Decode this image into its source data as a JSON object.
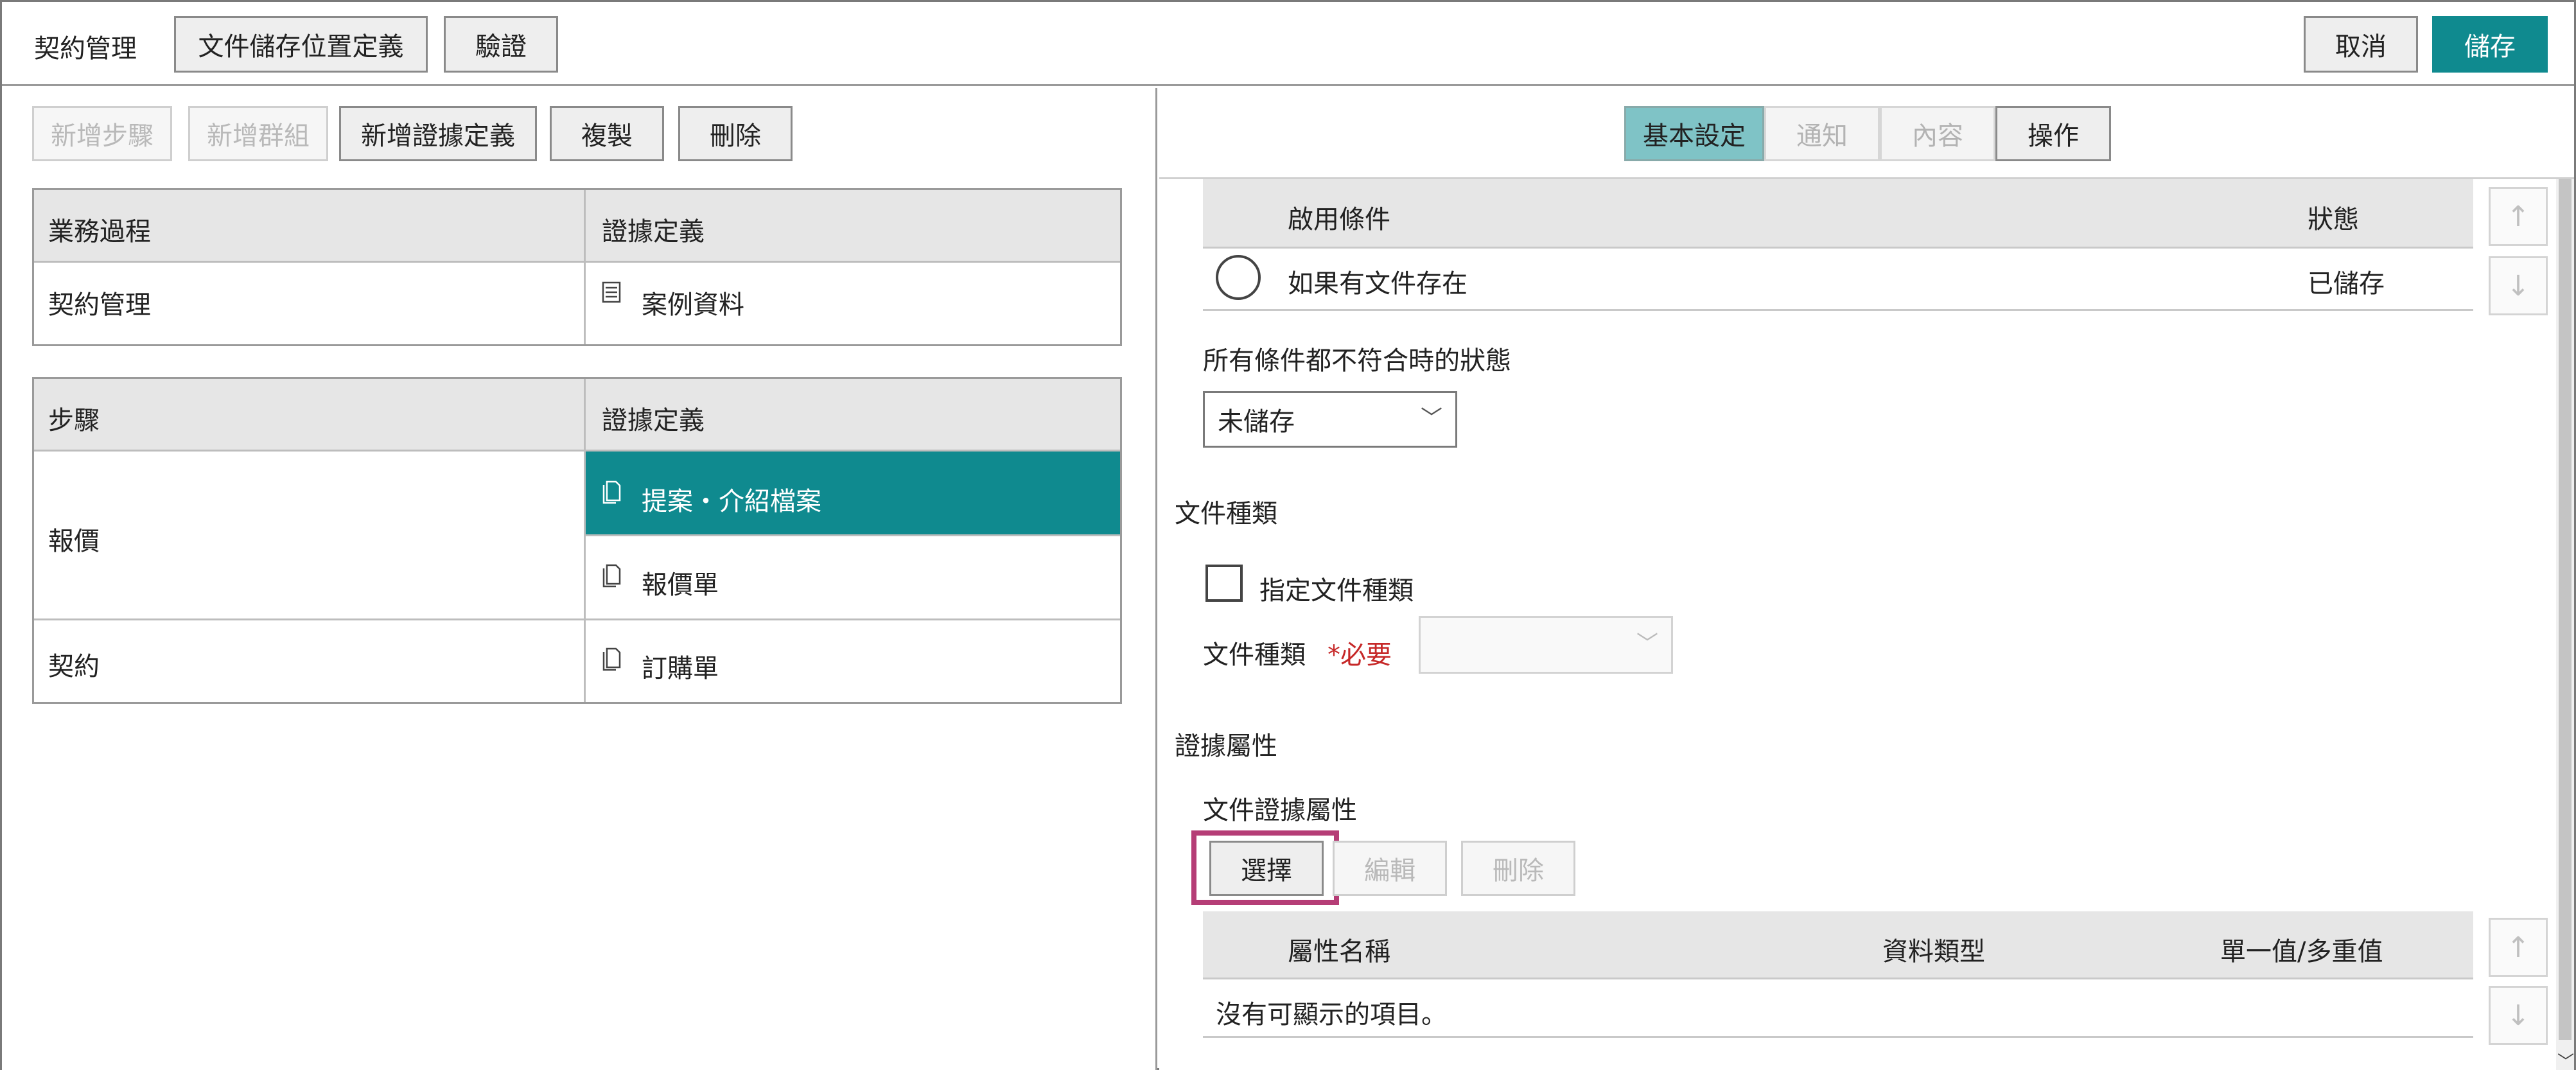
{
  "topbar": {
    "title": "契約管理",
    "storage_button": "文件儲存位置定義",
    "verify_button": "驗證",
    "cancel_button": "取消",
    "save_button": "儲存"
  },
  "left": {
    "toolbar": {
      "add_step": "新增步驟",
      "add_group": "新增群組",
      "add_evidence": "新增證據定義",
      "copy": "複製",
      "delete": "刪除"
    },
    "process_table": {
      "headers": [
        "業務過程",
        "證據定義"
      ],
      "rows": [
        {
          "process": "契約管理",
          "evidence": "案例資料",
          "icon": "list-icon"
        }
      ]
    },
    "steps_table": {
      "headers": [
        "步驟",
        "證據定義"
      ],
      "rows": [
        {
          "step": "報價",
          "evidence": [
            "提案・介紹檔案",
            "報價單"
          ]
        },
        {
          "step": "契約",
          "evidence": [
            "訂購單"
          ]
        }
      ],
      "selected": "提案・介紹檔案"
    }
  },
  "right": {
    "tabs": [
      {
        "label": "基本設定",
        "state": "active"
      },
      {
        "label": "通知",
        "state": "disabled"
      },
      {
        "label": "內容",
        "state": "disabled"
      },
      {
        "label": "操作",
        "state": "normal"
      }
    ],
    "conditions": {
      "headers": {
        "condition": "啟用條件",
        "status": "狀態"
      },
      "rows": [
        {
          "condition": "如果有文件存在",
          "status": "已儲存"
        }
      ]
    },
    "fallback_label": "所有條件都不符合時的狀態",
    "fallback_value": "未儲存",
    "doc_type_section": "文件種類",
    "specify_doc_type": "指定文件種類",
    "doc_type_label": "文件種類",
    "required_mark": "*必要",
    "evidence_attr_section": "證據屬性",
    "doc_evidence_attr_label": "文件證據屬性",
    "attr_buttons": {
      "select": "選擇",
      "edit": "編輯",
      "delete": "刪除"
    },
    "attr_table": {
      "headers": {
        "name": "屬性名稱",
        "type": "資料類型",
        "multi": "單一值/多重值"
      },
      "empty": "沒有可顯示的項目。"
    },
    "arrows": {
      "up": "↑",
      "down": "↓"
    }
  },
  "colors": {
    "accent": "#0f8a8f",
    "highlight": "#b53d76",
    "required": "#c62828"
  }
}
